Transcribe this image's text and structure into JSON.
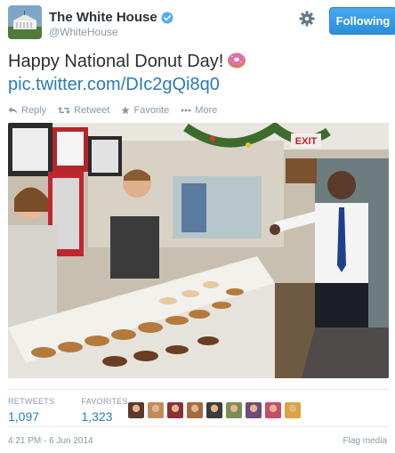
{
  "account": {
    "display_name": "The White House",
    "handle": "@WhiteHouse",
    "follow_label": "Following"
  },
  "tweet": {
    "text": "Happy National Donut Day!",
    "link": "pic.twitter.com/DIc2gQi8q0"
  },
  "actions": {
    "reply": "Reply",
    "retweet": "Retweet",
    "favorite": "Favorite",
    "more": "More"
  },
  "stats": {
    "retweets_label": "RETWEETS",
    "retweets_value": "1,097",
    "favorites_label": "FAVORITES",
    "favorites_value": "1,323"
  },
  "favoriter_avatar_colors": [
    "#5a3a2c",
    "#c08a5a",
    "#8a2f3a",
    "#a76a3f",
    "#3b3b3b",
    "#7a8f52",
    "#6b4c7a",
    "#c94a6a",
    "#d9a441"
  ],
  "footer": {
    "timestamp": "4:21 PM - 6 Jun 2014",
    "flag_media": "Flag media"
  },
  "colors": {
    "accent": "#2b7bb9",
    "follow_button": "#3a9ae6",
    "verified": "#55acee"
  },
  "icons": [
    "white-house-avatar",
    "verified-badge-icon",
    "gear-icon",
    "donut-emoji",
    "reply-icon",
    "retweet-icon",
    "star-icon",
    "more-dots-icon"
  ]
}
